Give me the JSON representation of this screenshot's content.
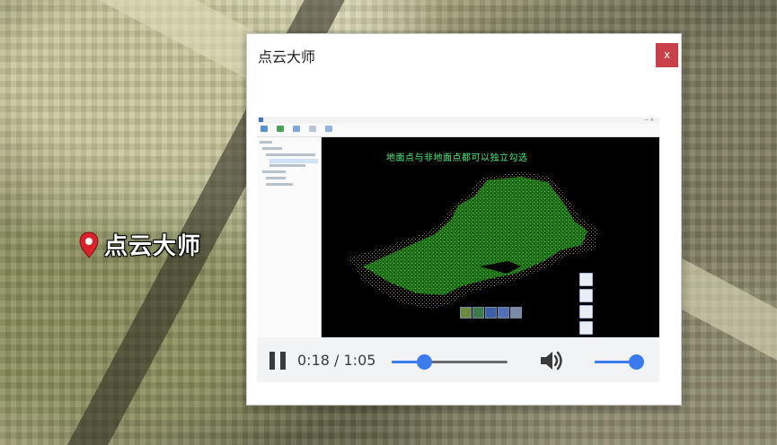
{
  "map": {
    "label": "点云大师"
  },
  "dialog": {
    "title": "点云大师",
    "close_label": "x"
  },
  "video": {
    "caption": "地面点与非地面点都可以独立勾选",
    "playback": {
      "time_display": "0:18 / 1:05",
      "current_seconds": 18,
      "duration_seconds": 65,
      "volume_fraction": 1.0
    }
  },
  "icons": {
    "map_pin": "map-pin-icon",
    "pause": "pause-icon",
    "volume": "volume-icon"
  },
  "colors": {
    "close_button": "#c9404a",
    "accent": "#3b7bf0",
    "pin": "#d8232a",
    "video_caption": "#4ff07e"
  }
}
